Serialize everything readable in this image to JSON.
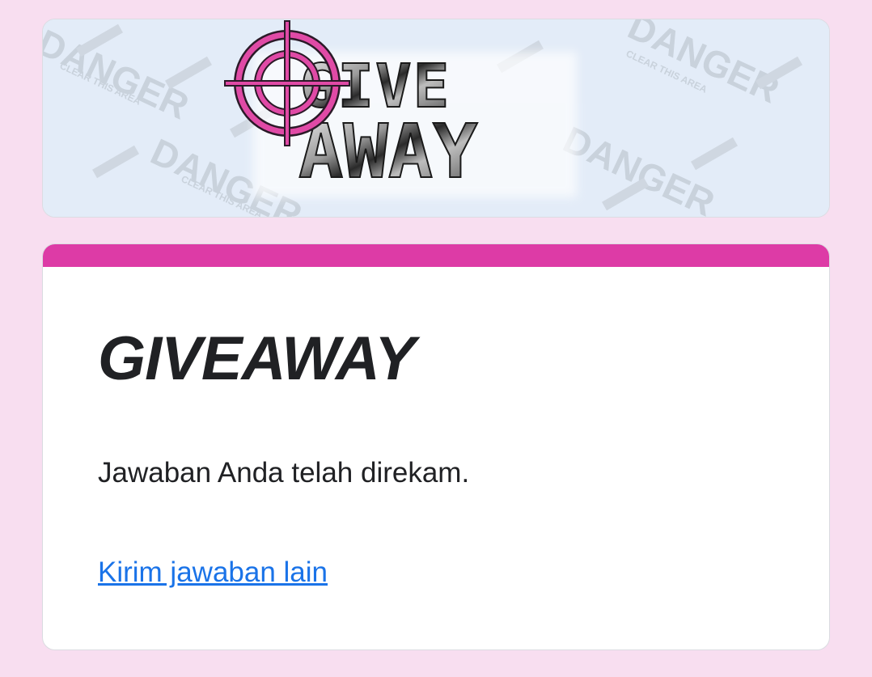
{
  "header": {
    "banner_logo_text_top": "GIVE",
    "banner_logo_text_bottom": "AWAY",
    "banner_watermark_word": "DANGER",
    "banner_watermark_sub": "CLEAR THIS AREA"
  },
  "form": {
    "title": "GIVEAWAY",
    "confirmation_message": "Jawaban Anda telah direkam.",
    "submit_another_label": "Kirim jawaban lain"
  },
  "colors": {
    "page_background": "#f8def0",
    "accent": "#dd3ba6",
    "link": "#1a73e8",
    "text": "#202124"
  },
  "icons": {
    "crosshair": "crosshair-icon"
  }
}
